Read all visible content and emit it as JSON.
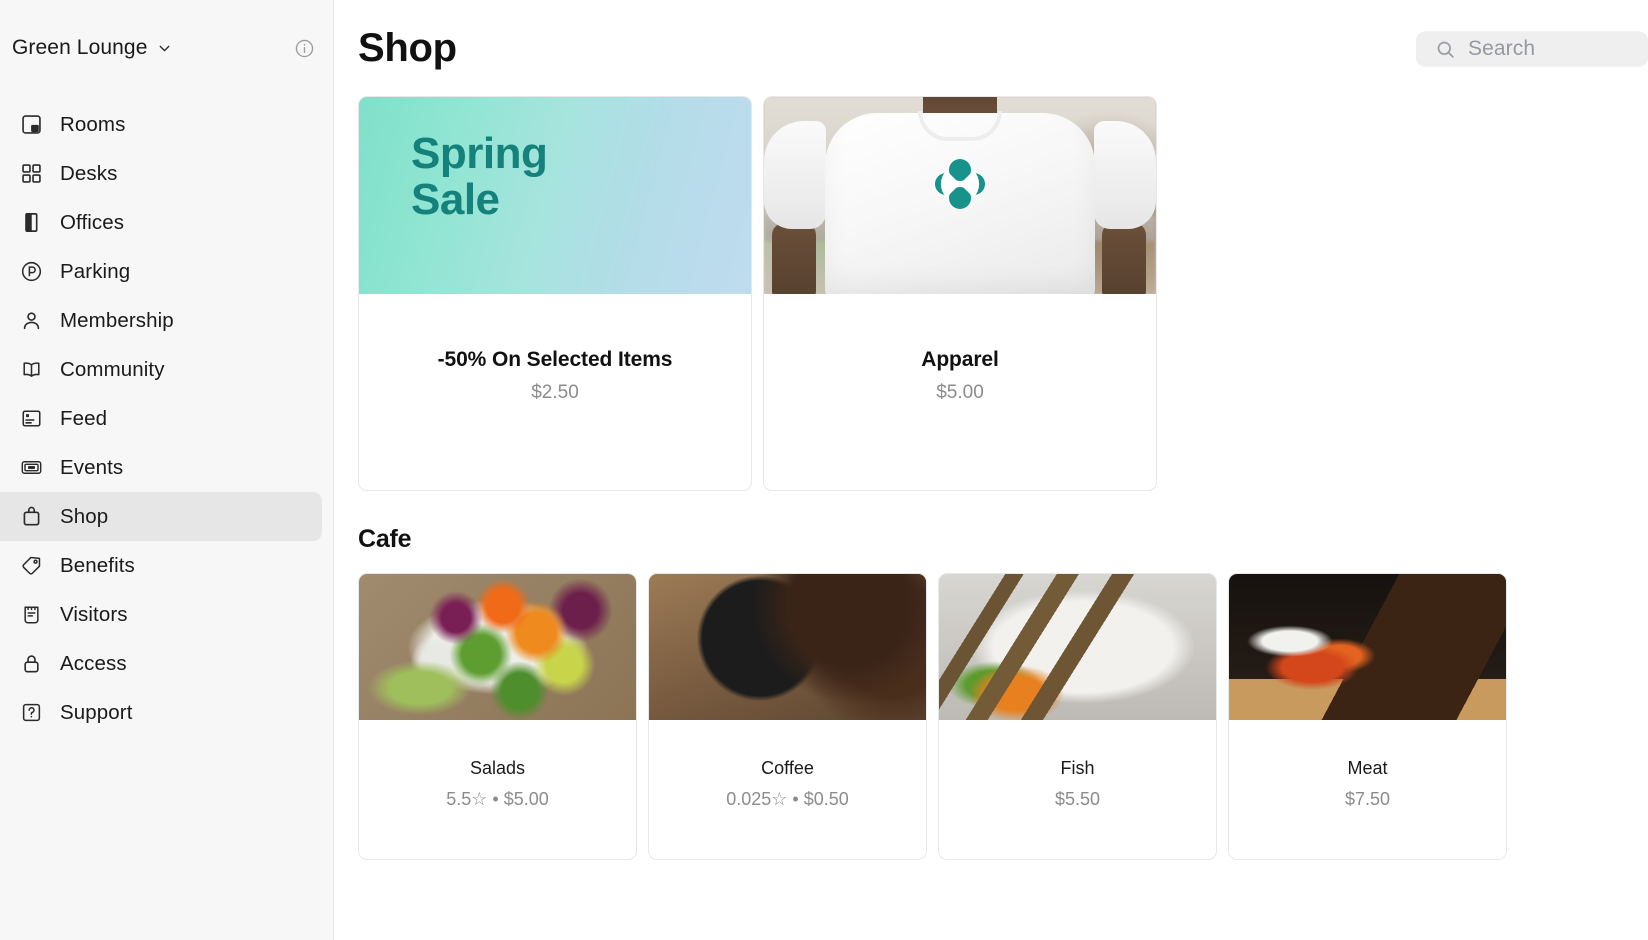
{
  "sidebar": {
    "workspace": {
      "name": "Green Lounge",
      "chevron_icon": "chevron-down-icon",
      "info_icon": "info-circle-icon"
    },
    "items": [
      {
        "label": "Rooms",
        "icon": "rooms-icon",
        "active": false
      },
      {
        "label": "Desks",
        "icon": "desks-grid-icon",
        "active": false
      },
      {
        "label": "Offices",
        "icon": "door-icon",
        "active": false
      },
      {
        "label": "Parking",
        "icon": "parking-icon",
        "active": false
      },
      {
        "label": "Membership",
        "icon": "person-icon",
        "active": false
      },
      {
        "label": "Community",
        "icon": "book-icon",
        "active": false
      },
      {
        "label": "Feed",
        "icon": "feed-icon",
        "active": false
      },
      {
        "label": "Events",
        "icon": "ticket-icon",
        "active": false
      },
      {
        "label": "Shop",
        "icon": "bag-icon",
        "active": true
      },
      {
        "label": "Benefits",
        "icon": "tag-icon",
        "active": false
      },
      {
        "label": "Visitors",
        "icon": "clipboard-icon",
        "active": false
      },
      {
        "label": "Access",
        "icon": "lock-icon",
        "active": false
      },
      {
        "label": "Support",
        "icon": "help-box-icon",
        "active": false
      }
    ]
  },
  "header": {
    "title": "Shop",
    "search": {
      "placeholder": "Search",
      "value": "",
      "icon": "search-icon"
    }
  },
  "promo": {
    "cards": [
      {
        "media": "spring-sale-gradient-banner",
        "banner_line1": "Spring",
        "banner_line2": "Sale",
        "title": "-50% On Selected Items",
        "price": "$2.50"
      },
      {
        "media": "apparel-tshirt-photo",
        "title": "Apparel",
        "price": "$5.00"
      }
    ]
  },
  "cafe": {
    "section_title": "Cafe",
    "items": [
      {
        "title": "Salads",
        "meta": "5.5☆ • $5.00",
        "rating": "5.5",
        "price": "$5.00",
        "media": "salad-photo"
      },
      {
        "title": "Coffee",
        "meta": "0.025☆ • $0.50",
        "rating": "0.025",
        "price": "$0.50",
        "media": "coffee-photo"
      },
      {
        "title": "Fish",
        "meta": "$5.50",
        "rating": "",
        "price": "$5.50",
        "media": "fish-photo"
      },
      {
        "title": "Meat",
        "meta": "$7.50",
        "rating": "",
        "price": "$7.50",
        "media": "meat-photo"
      }
    ]
  },
  "colors": {
    "brand_teal": "#14817B",
    "sidebar_bg": "#F7F7F7",
    "active_item_bg": "#E6E6E6",
    "search_bg": "#EFEFEF",
    "muted_text": "#8C8C8C",
    "gradient_start": "#7FE0CA",
    "gradient_end": "#BFDCEE"
  }
}
